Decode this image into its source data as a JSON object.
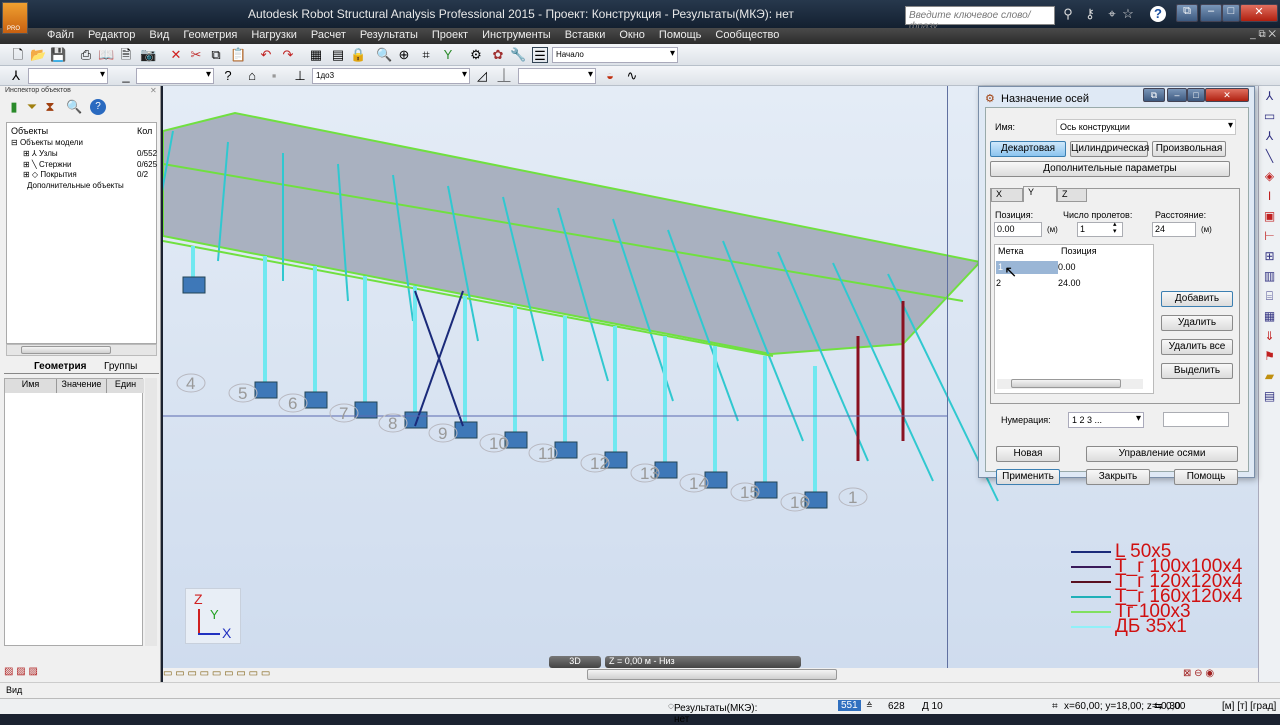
{
  "app": {
    "title": "Autodesk Robot Structural Analysis Professional 2015 - Проект: Конструкция - Результаты(МКЭ): нет",
    "logo_text": "PRO",
    "search_placeholder": "Введите ключевое слово/фразу"
  },
  "menu": [
    "Файл",
    "Редактор",
    "Вид",
    "Геометрия",
    "Нагрузки",
    "Расчет",
    "Результаты",
    "Проект",
    "Инструменты",
    "Вставки",
    "Окно",
    "Помощь",
    "Сообщество"
  ],
  "toolbar": {
    "layout_combo": "Начало",
    "case_combo": "1до3"
  },
  "inspector": {
    "title": "Инспектор объектов",
    "col_objects": "Объекты",
    "col_count": "Кол",
    "tree": [
      {
        "label": "Объекты модели",
        "count": "",
        "level": 0
      },
      {
        "label": "Узлы",
        "count": "0/552",
        "level": 1
      },
      {
        "label": "Стержни",
        "count": "0/625",
        "level": 1
      },
      {
        "label": "Покрытия",
        "count": "0/2",
        "level": 1
      },
      {
        "label": "Дополнительные объекты",
        "count": "",
        "level": 0
      }
    ],
    "tabs": [
      "Геометрия",
      "Группы"
    ],
    "props_cols": [
      "Имя",
      "Значение",
      "Един"
    ],
    "view_label": "Вид"
  },
  "viewport": {
    "axis_labels": [
      "4",
      "5",
      "6",
      "7",
      "8",
      "9",
      "10",
      "11",
      "12",
      "13",
      "14",
      "15",
      "16",
      "1"
    ],
    "view_mode": "3D",
    "plane": "Z = 0,00 м - Низ",
    "triad": {
      "z": "Z",
      "y": "Y",
      "x": "X"
    },
    "legend": [
      {
        "label": "L 50x5",
        "color": "#1a2a7a"
      },
      {
        "label": "T_г 100x100x4",
        "color": "#3a1a5a"
      },
      {
        "label": "T_г 120x120x4",
        "color": "#5a1020"
      },
      {
        "label": "T_г 160x120x4",
        "color": "#20b0b8"
      },
      {
        "label": "Tг 100x3",
        "color": "#80e060"
      },
      {
        "label": "ДБ 35x1",
        "color": "#90f0f8"
      }
    ]
  },
  "dialog": {
    "title": "Назначение осей",
    "name_label": "Имя:",
    "name_value": "Ось конструкции",
    "type_buttons": [
      "Декартовая",
      "Цилиндрическая",
      "Произвольная"
    ],
    "extra_params": "Дополнительные параметры",
    "tabs": [
      "X",
      "Y",
      "Z"
    ],
    "position_label": "Позиция:",
    "position_value": "0.00",
    "spans_label": "Число пролетов:",
    "spans_value": "1",
    "distance_label": "Расстояние:",
    "distance_value": "24",
    "unit": "(м)",
    "list_cols": [
      "Метка",
      "Позиция"
    ],
    "rows": [
      {
        "mark": "1",
        "pos": "0.00"
      },
      {
        "mark": "2",
        "pos": "24.00"
      }
    ],
    "side_buttons": [
      "Добавить",
      "Удалить",
      "Удалить все",
      "Выделить"
    ],
    "numbering_label": "Нумерация:",
    "numbering_value": "1 2 3 ...",
    "bottom_buttons": [
      "Новая",
      "Управление осями",
      "Применить",
      "Закрыть",
      "Помощь"
    ]
  },
  "status": {
    "results": "Результаты(МКЭ): нет",
    "nodes": "551",
    "bars": "628",
    "d": "Д 10",
    "coords": "x=60,00; y=18,00; z=-0,30",
    "angle": "0,00",
    "units": "[м] [т] [град]"
  }
}
